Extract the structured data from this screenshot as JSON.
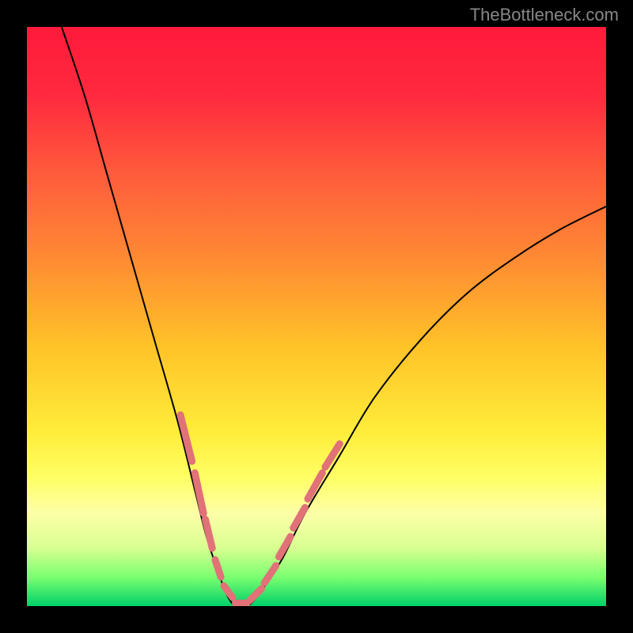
{
  "watermark": "TheBottleneck.com",
  "chart_data": {
    "type": "line",
    "title": "",
    "xlabel": "",
    "ylabel": "",
    "xlim": [
      0,
      100
    ],
    "ylim": [
      0,
      100
    ],
    "background": {
      "type": "vertical-gradient",
      "stops": [
        {
          "offset": 0,
          "color": "#ff1a3a"
        },
        {
          "offset": 12,
          "color": "#ff2a3f"
        },
        {
          "offset": 25,
          "color": "#ff5a3c"
        },
        {
          "offset": 40,
          "color": "#ff8a33"
        },
        {
          "offset": 55,
          "color": "#ffc228"
        },
        {
          "offset": 70,
          "color": "#ffed3a"
        },
        {
          "offset": 78,
          "color": "#ffff66"
        },
        {
          "offset": 84,
          "color": "#fdffa8"
        },
        {
          "offset": 90,
          "color": "#d8ff90"
        },
        {
          "offset": 95,
          "color": "#7aff70"
        },
        {
          "offset": 100,
          "color": "#00d068"
        }
      ]
    },
    "series": [
      {
        "name": "bottleneck-curve",
        "stroke": "#000000",
        "stroke_width": 2,
        "x": [
          6,
          10,
          14,
          18,
          22,
          26,
          29,
          31,
          33,
          34.5,
          36,
          38,
          40,
          44,
          48,
          54,
          60,
          68,
          76,
          84,
          92,
          100
        ],
        "y": [
          100,
          88,
          74,
          60,
          46,
          32,
          20,
          12,
          6,
          2,
          0,
          0,
          2,
          8,
          16,
          26,
          36,
          46,
          54,
          60,
          65,
          69
        ]
      }
    ],
    "dashed_overlay": {
      "name": "sample-dots",
      "stroke": "#e07278",
      "segments": [
        {
          "x": [
            26.5,
            28.5
          ],
          "y": [
            33,
            25
          ]
        },
        {
          "x": [
            29.0,
            30.5
          ],
          "y": [
            23,
            16
          ]
        },
        {
          "x": [
            30.8,
            32.0
          ],
          "y": [
            15,
            10
          ]
        },
        {
          "x": [
            32.5,
            33.5
          ],
          "y": [
            8,
            5
          ]
        },
        {
          "x": [
            34.0,
            35.5
          ],
          "y": [
            3.5,
            1.5
          ]
        },
        {
          "x": [
            36.0,
            38.0
          ],
          "y": [
            0.5,
            0.5
          ]
        },
        {
          "x": [
            38.5,
            40.5
          ],
          "y": [
            1,
            3
          ]
        },
        {
          "x": [
            41.0,
            43.0
          ],
          "y": [
            4,
            7
          ]
        },
        {
          "x": [
            43.5,
            45.5
          ],
          "y": [
            8.5,
            12
          ]
        },
        {
          "x": [
            46.0,
            48.0
          ],
          "y": [
            13.5,
            17
          ]
        },
        {
          "x": [
            48.5,
            51.0
          ],
          "y": [
            18.5,
            23
          ]
        },
        {
          "x": [
            51.5,
            54.0
          ],
          "y": [
            24,
            28
          ]
        }
      ]
    }
  }
}
